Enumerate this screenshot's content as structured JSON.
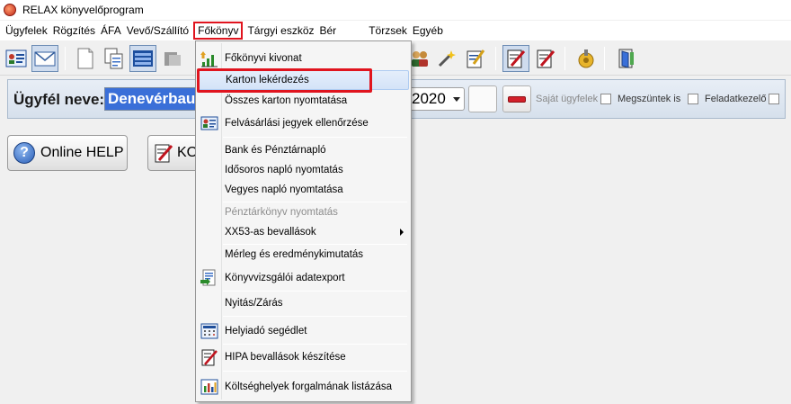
{
  "window": {
    "title": "RELAX könyvelőprogram"
  },
  "menubar": {
    "items": [
      {
        "label": "Ügyfelek"
      },
      {
        "label": "Rögzítés"
      },
      {
        "label": "ÁFA"
      },
      {
        "label": "Vevő/Szállító"
      },
      {
        "label": "Főkönyv",
        "active": true
      },
      {
        "label": "Tárgyi eszköz"
      },
      {
        "label": "Bér"
      },
      {
        "label": "Törzsek"
      },
      {
        "label": "Egyéb"
      }
    ]
  },
  "client_bar": {
    "label": "Ügyfél neve:",
    "client_value": "Denevérbau Kft",
    "year": "2020",
    "checkboxes": [
      {
        "label": "Saját ügyfelek",
        "checked": false
      },
      {
        "label": "Megszüntek is",
        "checked": false
      },
      {
        "label": "Feladatkezelő",
        "checked": false
      }
    ]
  },
  "buttons": {
    "online_help": "Online HELP",
    "second": "KONTIR"
  },
  "fokonyv_menu": {
    "items": [
      {
        "label": "Főkönyvi kivonat",
        "icon": "ledger-chart-icon"
      },
      {
        "label": "Karton lekérdezés",
        "highlighted": true
      },
      {
        "label": "Összes karton nyomtatása"
      },
      {
        "label": "Felvásárlási jegyek ellenőrzése",
        "icon": "id-card-icon"
      },
      {
        "label": "Bank és Pénztárnapló"
      },
      {
        "label": "Idősoros napló nyomtatás"
      },
      {
        "label": "Vegyes napló nyomtatása"
      },
      {
        "label": "Pénztárkönyv nyomtatás",
        "disabled": true
      },
      {
        "label": "XX53-as bevallások",
        "submenu": true
      },
      {
        "label": "Mérleg és eredménykimutatás"
      },
      {
        "label": "Könyvvizsgálói adatexport",
        "icon": "export-document-icon"
      },
      {
        "label": "Nyitás/Zárás"
      },
      {
        "label": "Helyiadó segédlet",
        "icon": "calculator-grid-icon"
      },
      {
        "label": "HIPA bevallások készítése",
        "icon": "pen-form-icon"
      },
      {
        "label": "Költséghelyek forgalmának listázása",
        "icon": "bar-chart-icon"
      }
    ]
  },
  "colors": {
    "highlight_border": "#e0141e",
    "client_input_bg": "#3a6fd8"
  }
}
